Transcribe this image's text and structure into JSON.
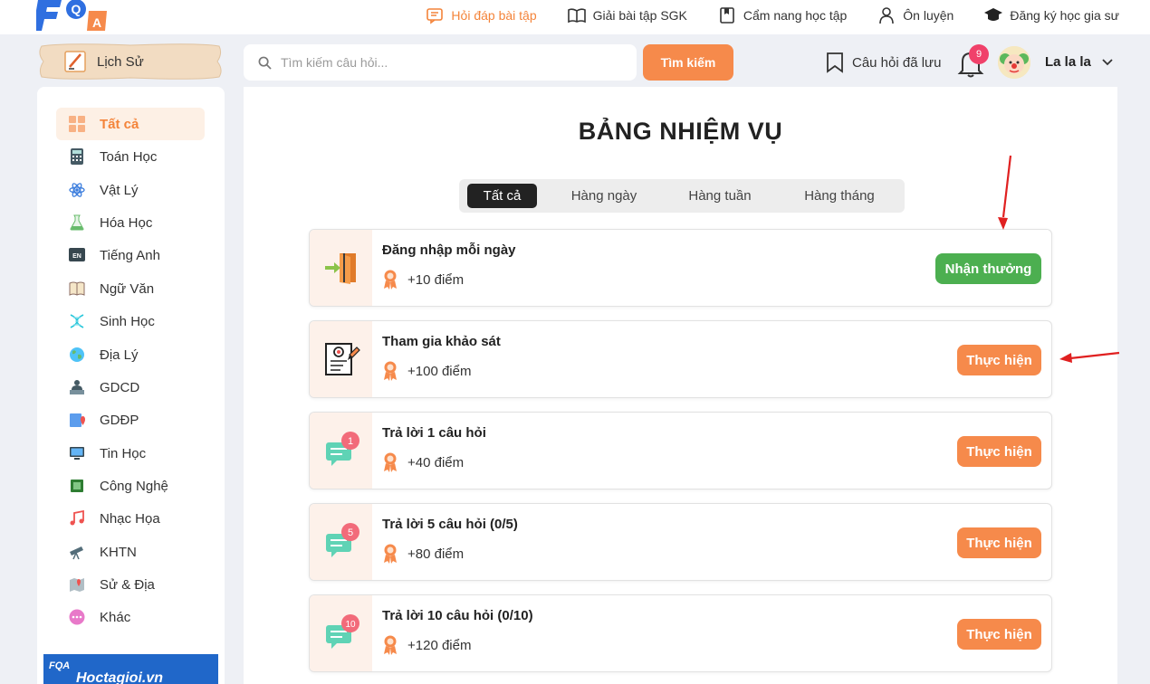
{
  "brand": {
    "logo_text": "FQA"
  },
  "topnav": [
    {
      "label": "Hỏi đáp bài tập",
      "icon": "chat-question-icon",
      "active": true
    },
    {
      "label": "Giải bài tập SGK",
      "icon": "open-book-icon",
      "active": false
    },
    {
      "label": "Cẩm nang học tập",
      "icon": "handbook-icon",
      "active": false
    },
    {
      "label": "Ôn luyện",
      "icon": "student-icon",
      "active": false
    },
    {
      "label": "Đăng ký học gia sư",
      "icon": "graduation-cap-icon",
      "active": false
    }
  ],
  "subject_tag": {
    "label": "Lịch Sử"
  },
  "search": {
    "placeholder": "Tìm kiếm câu hỏi...",
    "value": "",
    "button_label": "Tìm kiếm"
  },
  "header_right": {
    "saved_label": "Câu hỏi đã lưu",
    "notification_count": "9",
    "username": "La la la"
  },
  "sidebar": {
    "items": [
      {
        "label": "Tất cả",
        "icon": "grid-icon",
        "active": true
      },
      {
        "label": "Toán Học",
        "icon": "calculator-icon"
      },
      {
        "label": "Vật Lý",
        "icon": "atom-icon"
      },
      {
        "label": "Hóa Học",
        "icon": "flask-icon"
      },
      {
        "label": "Tiếng Anh",
        "icon": "english-icon"
      },
      {
        "label": "Ngữ Văn",
        "icon": "book-icon"
      },
      {
        "label": "Sinh Học",
        "icon": "dna-icon"
      },
      {
        "label": "Địa Lý",
        "icon": "globe-icon"
      },
      {
        "label": "GDCD",
        "icon": "person-desk-icon"
      },
      {
        "label": "GDĐP",
        "icon": "location-book-icon"
      },
      {
        "label": "Tin Học",
        "icon": "computer-icon"
      },
      {
        "label": "Công Nghệ",
        "icon": "chip-icon"
      },
      {
        "label": "Nhạc Họa",
        "icon": "music-note-icon"
      },
      {
        "label": "KHTN",
        "icon": "telescope-icon"
      },
      {
        "label": "Sử & Địa",
        "icon": "map-icon"
      },
      {
        "label": "Khác",
        "icon": "more-icon"
      }
    ],
    "promo_text": "Hoctagioi.vn"
  },
  "main": {
    "title": "BẢNG NHIỆM VỤ",
    "tabs": [
      {
        "label": "Tất cả",
        "active": true
      },
      {
        "label": "Hàng ngày"
      },
      {
        "label": "Hàng tuần"
      },
      {
        "label": "Hàng tháng"
      }
    ],
    "tasks": [
      {
        "name": "Đăng nhập mỗi ngày",
        "points": "+10 điểm",
        "button": "Nhận thưởng",
        "button_type": "claim",
        "icon": "login-door-icon"
      },
      {
        "name": "Tham gia khảo sát",
        "points": "+100 điểm",
        "button": "Thực hiện",
        "button_type": "do",
        "icon": "survey-icon"
      },
      {
        "name": "Trả lời 1 câu hỏi",
        "points": "+40 điểm",
        "button": "Thực hiện",
        "button_type": "do",
        "icon": "chat-bubble-icon",
        "icon_badge": "1"
      },
      {
        "name": "Trả lời 5 câu hỏi (0/5)",
        "points": "+80 điểm",
        "button": "Thực hiện",
        "button_type": "do",
        "icon": "chat-bubble-icon",
        "icon_badge": "5"
      },
      {
        "name": "Trả lời 10 câu hỏi (0/10)",
        "points": "+120 điểm",
        "button": "Thực hiện",
        "button_type": "do",
        "icon": "chat-bubble-icon",
        "icon_badge": "10"
      }
    ]
  },
  "colors": {
    "accent": "#f68a4b",
    "claim": "#4caf50",
    "annotation": "#e02020"
  }
}
